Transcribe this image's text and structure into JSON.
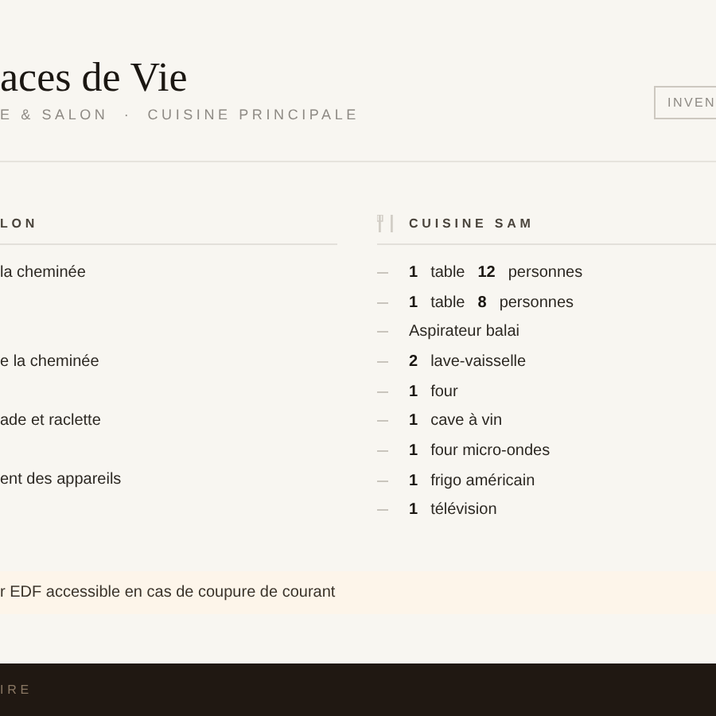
{
  "header": {
    "title": "aces de Vie",
    "subtitle": "E & SALON  ·  CUISINE PRINCIPALE",
    "button": "INVEN"
  },
  "rooms": [
    {
      "title": "LON",
      "icon": false,
      "items": [
        {
          "name": "la cheminée"
        },
        {
          "name": "e la cheminée"
        },
        {
          "name": "ade et raclette"
        },
        {
          "name": "ent des appareils"
        }
      ]
    },
    {
      "title": "CUISINE SAM",
      "icon": true,
      "items": [
        {
          "quantity": "1",
          "name": "table",
          "count": "12",
          "suffix": "personnes"
        },
        {
          "quantity": "1",
          "name": "table",
          "count": "8",
          "suffix": "personnes"
        },
        {
          "name": "Aspirateur balai"
        },
        {
          "quantity": "2",
          "name": "lave-vaisselle"
        },
        {
          "quantity": "1",
          "name": "four"
        },
        {
          "quantity": "1",
          "name": "cave à vin"
        },
        {
          "quantity": "1",
          "name": "four micro-ondes"
        },
        {
          "quantity": "1",
          "name": "frigo américain"
        },
        {
          "quantity": "1",
          "name": "télévision"
        }
      ]
    }
  ],
  "notice": "r EDF accessible en cas de coupure de courant",
  "footer": "IRE"
}
